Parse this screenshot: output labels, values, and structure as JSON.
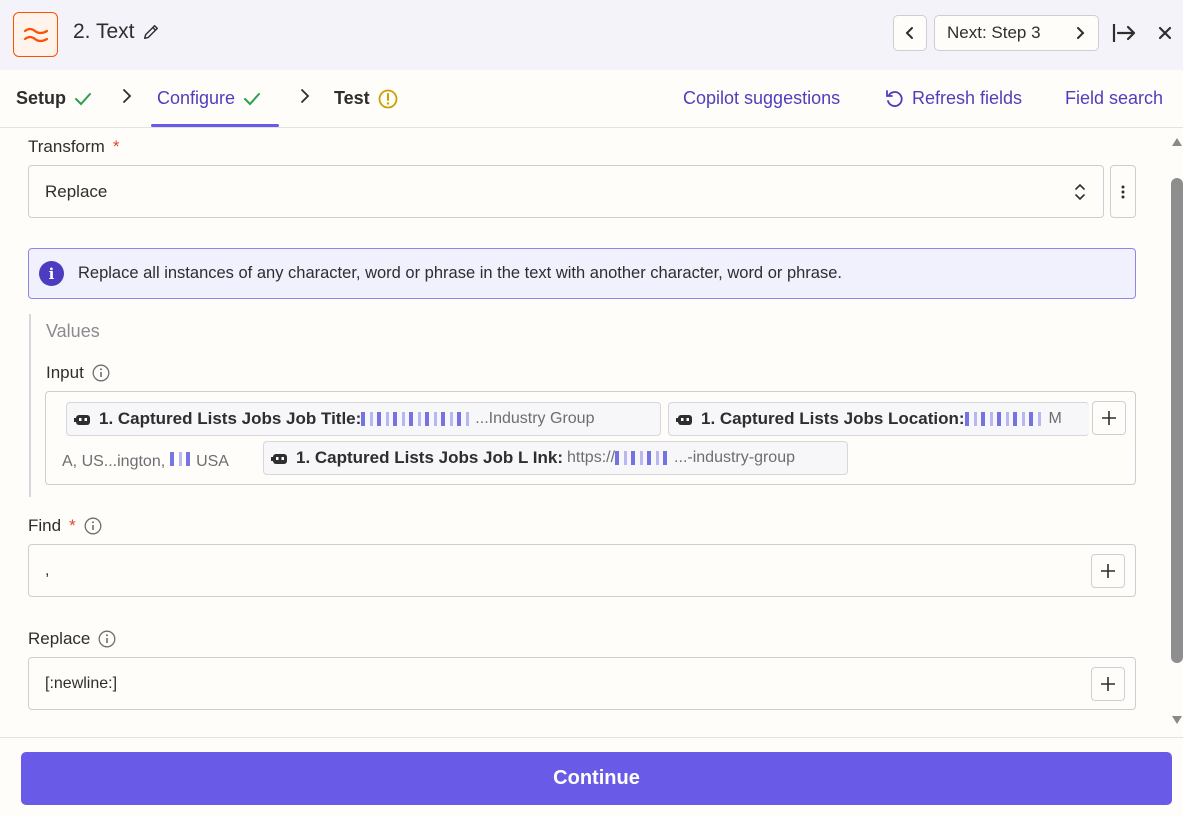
{
  "header": {
    "step_title": "2. Text",
    "next_label": "Next: Step 3"
  },
  "tabs": {
    "setup": "Setup",
    "configure": "Configure",
    "test": "Test",
    "copilot": "Copilot suggestions",
    "refresh": "Refresh fields",
    "field_search": "Field search"
  },
  "form": {
    "transform_label": "Transform",
    "transform_value": "Replace",
    "info_text": "Replace all instances of any character, word or phrase in the text with another character, word or phrase.",
    "values_title": "Values",
    "input_label": "Input",
    "pills": [
      {
        "label": "1. Captured Lists Jobs Job Title:",
        "value": "...Industry Group"
      },
      {
        "label": "1. Captured Lists Jobs Location:",
        "value": "M"
      },
      {
        "label": "1. Captured Lists Jobs Job L Ink:",
        "value": "https://"
      }
    ],
    "pill3_value_end": "...-industry-group",
    "wrap_text_a": "A, US...ington,",
    "wrap_text_b": "USA",
    "find_label": "Find",
    "find_value": ",",
    "replace_label": "Replace",
    "replace_value": "[:newline:]",
    "required_mark": "*"
  },
  "footer": {
    "continue_label": "Continue"
  },
  "colors": {
    "accent": "#695be8",
    "brand_orange": "#ff4f00",
    "success": "#2e9e4f",
    "warning": "#c9a100"
  }
}
